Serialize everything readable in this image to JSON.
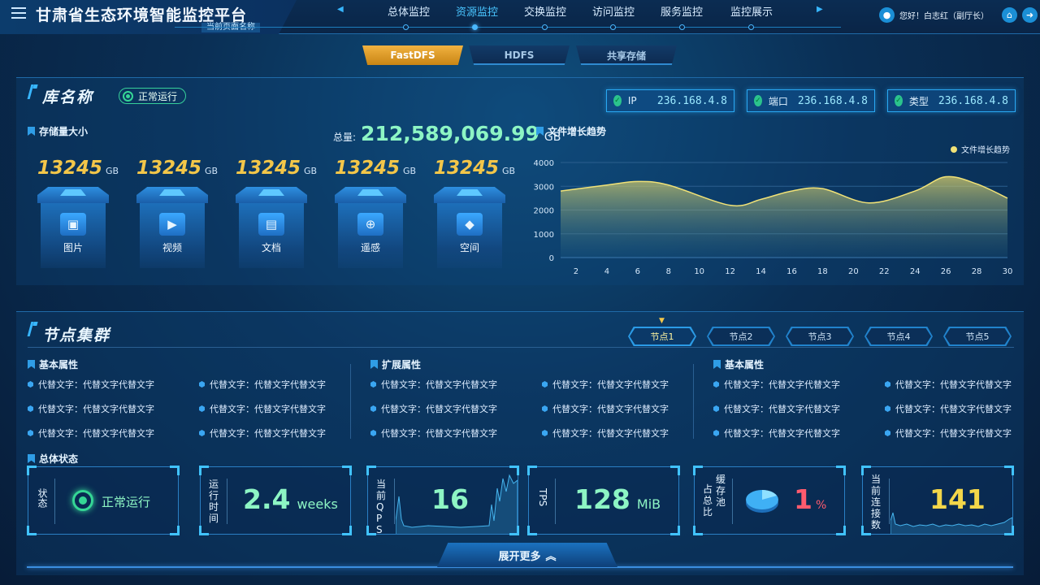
{
  "header": {
    "title": "甘肃省生态环境智能监控平台",
    "subtitle": "当前页面名称",
    "nav": [
      {
        "label": "总体监控",
        "active": false
      },
      {
        "label": "资源监控",
        "active": true
      },
      {
        "label": "交换监控",
        "active": false
      },
      {
        "label": "访问监控",
        "active": false
      },
      {
        "label": "服务监控",
        "active": false
      },
      {
        "label": "监控展示",
        "active": false
      }
    ],
    "greeting": "您好！白志红（副厅长）"
  },
  "storage_tabs": [
    {
      "label": "FastDFS",
      "active": true
    },
    {
      "label": "HDFS",
      "active": false
    },
    {
      "label": "共享存储",
      "active": false
    }
  ],
  "library": {
    "title": "库名称",
    "status": "正常运行",
    "info": [
      {
        "label": "IP",
        "value": "236.168.4.8"
      },
      {
        "label": "端口",
        "value": "236.168.4.8"
      },
      {
        "label": "类型",
        "value": "236.168.4.8"
      }
    ],
    "storage_label": "存储量大小",
    "total_label": "总量:",
    "total_value": "212,589,069.99",
    "total_unit": "GB",
    "cards": [
      {
        "value": "13245",
        "unit": "GB",
        "label": "图片",
        "icon": "image-icon"
      },
      {
        "value": "13245",
        "unit": "GB",
        "label": "视频",
        "icon": "video-icon"
      },
      {
        "value": "13245",
        "unit": "GB",
        "label": "文档",
        "icon": "folder-icon"
      },
      {
        "value": "13245",
        "unit": "GB",
        "label": "遥感",
        "icon": "crosshair-icon"
      },
      {
        "value": "13245",
        "unit": "GB",
        "label": "空间",
        "icon": "cube-icon"
      }
    ]
  },
  "chart_data": {
    "type": "area",
    "title": "文件增长趋势",
    "legend": "文件增长趋势",
    "legend_position": "top-right",
    "x_ticks": [
      2,
      4,
      6,
      8,
      10,
      12,
      14,
      16,
      18,
      20,
      22,
      24,
      26,
      28,
      30
    ],
    "y_ticks": [
      0,
      1000,
      2000,
      3000,
      4000
    ],
    "ylim": [
      0,
      4000
    ],
    "xlim": [
      1,
      30
    ],
    "grid": true,
    "color": "#f1e277",
    "series": [
      {
        "name": "文件增长趋势",
        "x": [
          1,
          4,
          6,
          8,
          12,
          14,
          16,
          18,
          21,
          24,
          26,
          28,
          30
        ],
        "y": [
          2800,
          3050,
          3200,
          3050,
          2200,
          2450,
          2800,
          2900,
          2300,
          2800,
          3400,
          3100,
          2500
        ]
      }
    ]
  },
  "nodes": {
    "title": "节点集群",
    "tabs": [
      {
        "label": "节点1",
        "active": true
      },
      {
        "label": "节点2",
        "active": false
      },
      {
        "label": "节点3",
        "active": false
      },
      {
        "label": "节点4",
        "active": false
      },
      {
        "label": "节点5",
        "active": false
      }
    ],
    "groups": [
      {
        "title": "基本属性",
        "items": [
          "代替文字：代替文字代替文字",
          "代替文字：代替文字代替文字",
          "代替文字：代替文字代替文字",
          "代替文字：代替文字代替文字",
          "代替文字：代替文字代替文字",
          "代替文字：代替文字代替文字"
        ]
      },
      {
        "title": "扩展属性",
        "items": [
          "代替文字：代替文字代替文字",
          "代替文字：代替文字代替文字",
          "代替文字：代替文字代替文字",
          "代替文字：代替文字代替文字",
          "代替文字：代替文字代替文字",
          "代替文字：代替文字代替文字"
        ]
      },
      {
        "title": "基本属性",
        "items": [
          "代替文字：代替文字代替文字",
          "代替文字：代替文字代替文字",
          "代替文字：代替文字代替文字",
          "代替文字：代替文字代替文字",
          "代替文字：代替文字代替文字",
          "代替文字：代替文字代替文字"
        ]
      }
    ],
    "overall_label": "总体状态",
    "status": {
      "state_label": "状态",
      "state_value": "正常运行",
      "uptime_label": "运行时间",
      "uptime_value": "2.4",
      "uptime_unit": "weeks",
      "qps_label": "当前QPS",
      "qps_value": "16",
      "tps_label": "TPS",
      "tps_value": "128",
      "tps_unit": "MiB",
      "cache_label_a": "占总比",
      "cache_label_b": "缓存池",
      "cache_value": "1",
      "cache_unit": "%",
      "conn_label": "当前连接数",
      "conn_value": "141"
    },
    "expand_label": "展开更多"
  }
}
